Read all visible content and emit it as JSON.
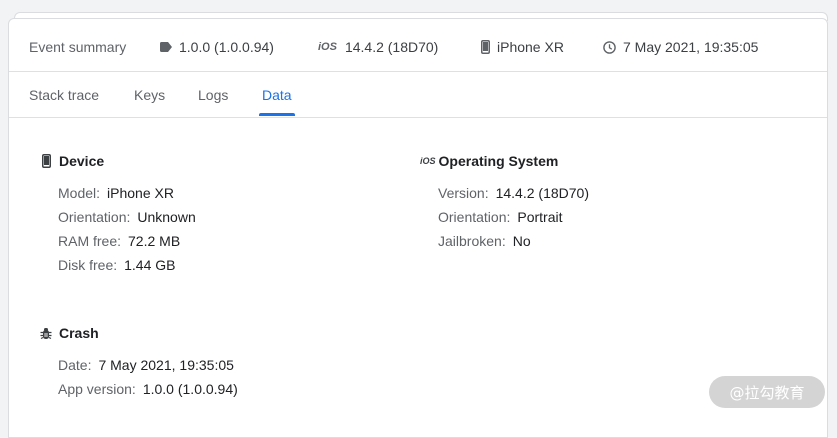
{
  "summary": {
    "label": "Event summary",
    "app_version": "1.0.0 (1.0.0.94)",
    "os_badge": "iOS",
    "os_version": "14.4.2 (18D70)",
    "device": "iPhone XR",
    "timestamp": "7 May 2021, 19:35:05"
  },
  "tabs": [
    {
      "label": "Stack trace"
    },
    {
      "label": "Keys"
    },
    {
      "label": "Logs"
    },
    {
      "label": "Data",
      "active": true
    }
  ],
  "device": {
    "title": "Device",
    "rows": [
      {
        "key": "Model:",
        "value": "iPhone XR"
      },
      {
        "key": "Orientation:",
        "value": "Unknown"
      },
      {
        "key": "RAM free:",
        "value": "72.2 MB"
      },
      {
        "key": "Disk free:",
        "value": "1.44 GB"
      }
    ]
  },
  "os": {
    "badge": "iOS",
    "title": "Operating System",
    "rows": [
      {
        "key": "Version:",
        "value": "14.4.2 (18D70)"
      },
      {
        "key": "Orientation:",
        "value": "Portrait"
      },
      {
        "key": "Jailbroken:",
        "value": "No"
      }
    ]
  },
  "crash": {
    "title": "Crash",
    "rows": [
      {
        "key": "Date:",
        "value": "7 May 2021, 19:35:05"
      },
      {
        "key": "App version:",
        "value": "1.0.0 (1.0.0.94)"
      }
    ]
  },
  "watermark": "@拉勾教育",
  "colors": {
    "accent": "#1a73e8",
    "muted": "#5f6368",
    "text": "#202124"
  },
  "icons": [
    "tag-icon",
    "ios-icon",
    "phone-icon",
    "clock-icon",
    "bug-icon"
  ]
}
